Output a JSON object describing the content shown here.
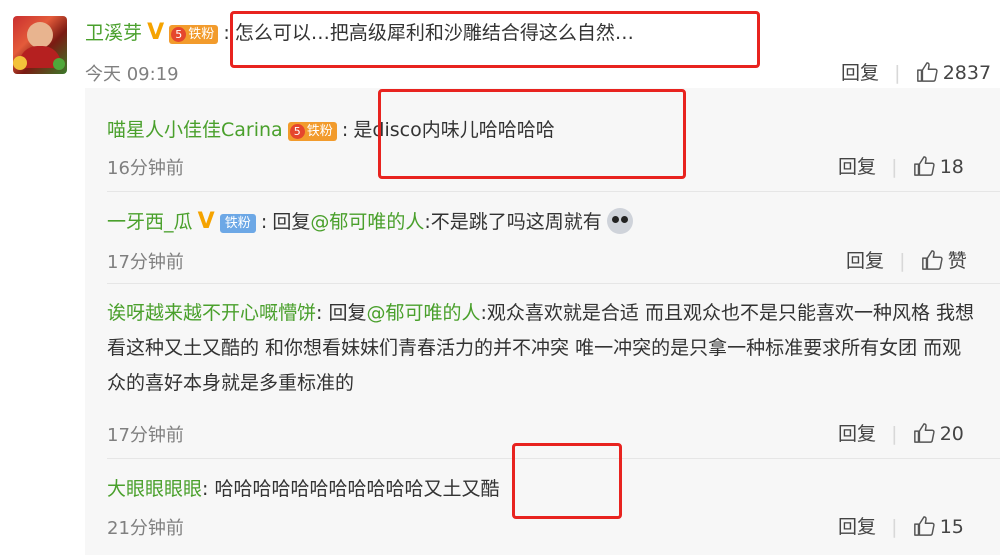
{
  "main_comment": {
    "user": "卫溪芽",
    "badge_level": "5",
    "badge_text": "铁粉",
    "separator": ":",
    "text": "怎么可以…把高级犀利和沙雕结合得这么自然…",
    "time": "今天 09:19",
    "reply_label": "回复",
    "likes": "2837"
  },
  "replies": [
    {
      "user": "喵星人小佳佳Carina",
      "badge_level": "5",
      "badge_text": "铁粉",
      "text": "是disco内味儿哈哈哈哈",
      "time": "16分钟前",
      "reply_label": "回复",
      "likes": "18"
    },
    {
      "user": "一牙西_瓜",
      "badge_text": "铁粉",
      "reply_prefix": "回复",
      "mention": "@郁可唯的人",
      "text": ":不是跳了吗这周就有",
      "time": "17分钟前",
      "reply_label": "回复",
      "likes": "赞"
    },
    {
      "user": "诶呀越来越不开心嘅懵饼",
      "reply_prefix": "回复",
      "mention": "@郁可唯的人",
      "text": ":观众喜欢就是合适 而且观众也不是只能喜欢一种风格 我想看这种又土又酷的 和你想看妹妹们青春活力的并不冲突 唯一冲突的是只拿一种标准要求所有女团 而观众的喜好本身就是多重标准的",
      "time": "17分钟前",
      "reply_label": "回复",
      "likes": "20"
    },
    {
      "user": "大眼眼眼眼",
      "text": "哈哈哈哈哈哈哈哈哈哈哈又土又酷",
      "time": "21分钟前",
      "reply_label": "回复",
      "likes": "15"
    }
  ],
  "colors": {
    "username": "#4aa02c",
    "highlight_box": "#e8231f",
    "badge": "#f29b2c",
    "badge_blue": "#6da8e6"
  }
}
